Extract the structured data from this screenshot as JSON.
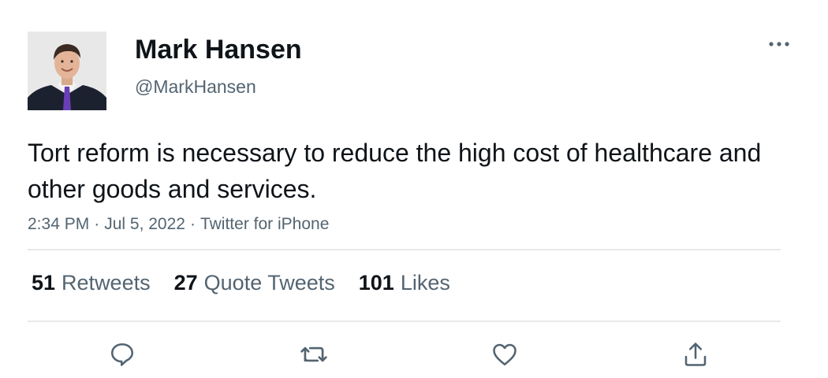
{
  "author": {
    "display_name": "Mark Hansen",
    "handle": "@MarkHansen",
    "avatar_icon": "profile-photo"
  },
  "tweet": {
    "text": "Tort reform is necessary to reduce the high cost of healthcare and other goods and services.",
    "time": "2:34 PM",
    "date": "Jul 5, 2022",
    "source": "Twitter for iPhone",
    "separator": "·"
  },
  "stats": {
    "retweets_count": "51",
    "retweets_label": "Retweets",
    "quotes_count": "27",
    "quotes_label": "Quote Tweets",
    "likes_count": "101",
    "likes_label": "Likes"
  },
  "actions": {
    "reply_icon": "reply-icon",
    "retweet_icon": "retweet-icon",
    "like_icon": "heart-icon",
    "share_icon": "share-icon",
    "more_icon": "more-icon"
  },
  "colors": {
    "text_primary": "#0f1419",
    "text_secondary": "#536471",
    "divider": "#e6e9eb",
    "tie_accent": "#6a3fb5"
  }
}
